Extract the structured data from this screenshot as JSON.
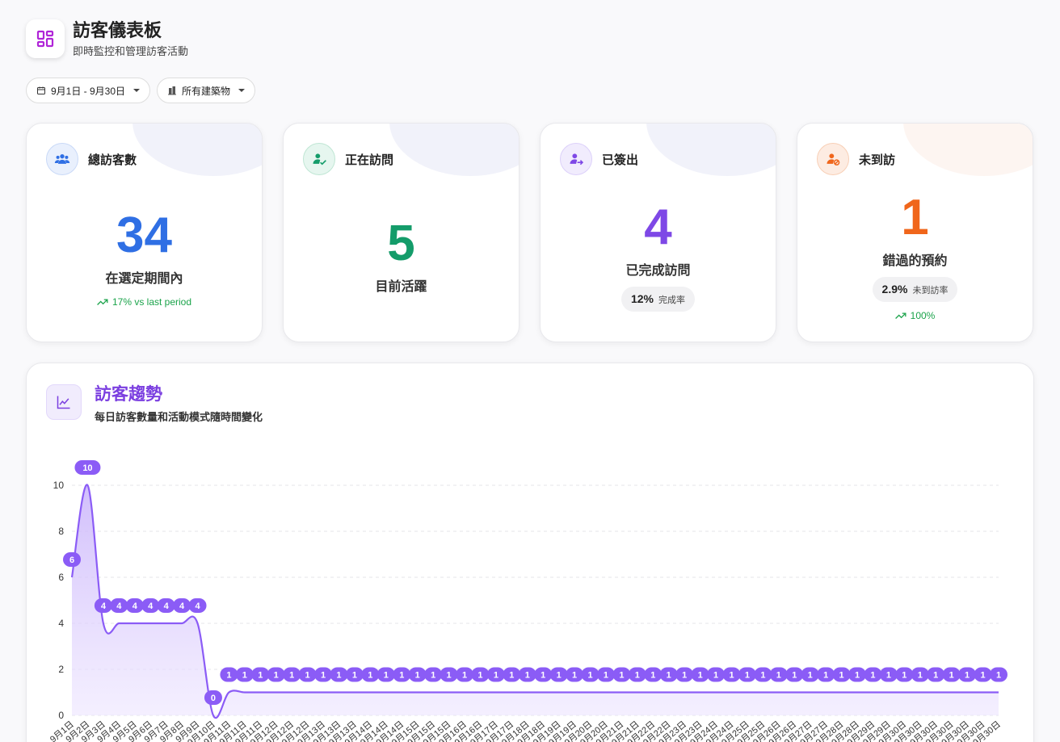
{
  "header": {
    "title": "訪客儀表板",
    "subtitle": "即時監控和管理訪客活動"
  },
  "filters": {
    "date_range": "9月1日 - 9月30日",
    "building": "所有建築物"
  },
  "cards": [
    {
      "label": "總訪客數",
      "value": "34",
      "desc": "在選定期間內",
      "trend": "17% vs last period",
      "color": "#2f6fe4",
      "icon": "people-icon"
    },
    {
      "label": "正在訪問",
      "value": "5",
      "desc": "目前活躍",
      "color": "#149c6a",
      "icon": "user-check-icon"
    },
    {
      "label": "已簽出",
      "value": "4",
      "desc": "已完成訪問",
      "pill_value": "12%",
      "pill_label": "完成率",
      "color": "#7e48e6",
      "icon": "user-arrow-icon"
    },
    {
      "label": "未到訪",
      "value": "1",
      "desc": "錯過的預約",
      "pill_value": "2.9%",
      "pill_label": "未到訪率",
      "trend": "100%",
      "color": "#f0661b",
      "icon": "user-block-icon"
    }
  ],
  "chart_section": {
    "title": "訪客趨勢",
    "subtitle": "每日訪客數量和活動模式隨時間變化"
  },
  "chart_data": {
    "type": "area",
    "x": [
      "9月1日",
      "9月2日",
      "9月3日",
      "9月4日",
      "9月5日",
      "9月6日",
      "9月7日",
      "9月8日",
      "9月9日",
      "9月10日",
      "9月11日",
      "9月11日",
      "9月11日",
      "9月12日",
      "9月12日",
      "9月12日",
      "9月13日",
      "9月13日",
      "9月13日",
      "9月14日",
      "9月14日",
      "9月14日",
      "9月15日",
      "9月15日",
      "9月15日",
      "9月16日",
      "9月16日",
      "9月17日",
      "9月17日",
      "9月18日",
      "9月18日",
      "9月19日",
      "9月19日",
      "9月20日",
      "9月20日",
      "9月21日",
      "9月21日",
      "9月22日",
      "9月22日",
      "9月23日",
      "9月23日",
      "9月24日",
      "9月24日",
      "9月25日",
      "9月25日",
      "9月26日",
      "9月26日",
      "9月27日",
      "9月27日",
      "9月28日",
      "9月28日",
      "9月29日",
      "9月29日",
      "9月30日",
      "9月30日",
      "9月30日",
      "9月30日",
      "9月30日",
      "9月30日",
      "9月30日"
    ],
    "values": [
      6,
      10,
      4,
      4,
      4,
      4,
      4,
      4,
      4,
      0,
      1,
      1,
      1,
      1,
      1,
      1,
      1,
      1,
      1,
      1,
      1,
      1,
      1,
      1,
      1,
      1,
      1,
      1,
      1,
      1,
      1,
      1,
      1,
      1,
      1,
      1,
      1,
      1,
      1,
      1,
      1,
      1,
      1,
      1,
      1,
      1,
      1,
      1,
      1,
      1,
      1,
      1,
      1,
      1,
      1,
      1,
      1,
      1,
      1,
      1
    ],
    "ylim": [
      0,
      10
    ],
    "yticks": [
      0,
      2,
      4,
      6,
      8,
      10
    ],
    "grid": true,
    "color": "#8b5cf6"
  }
}
